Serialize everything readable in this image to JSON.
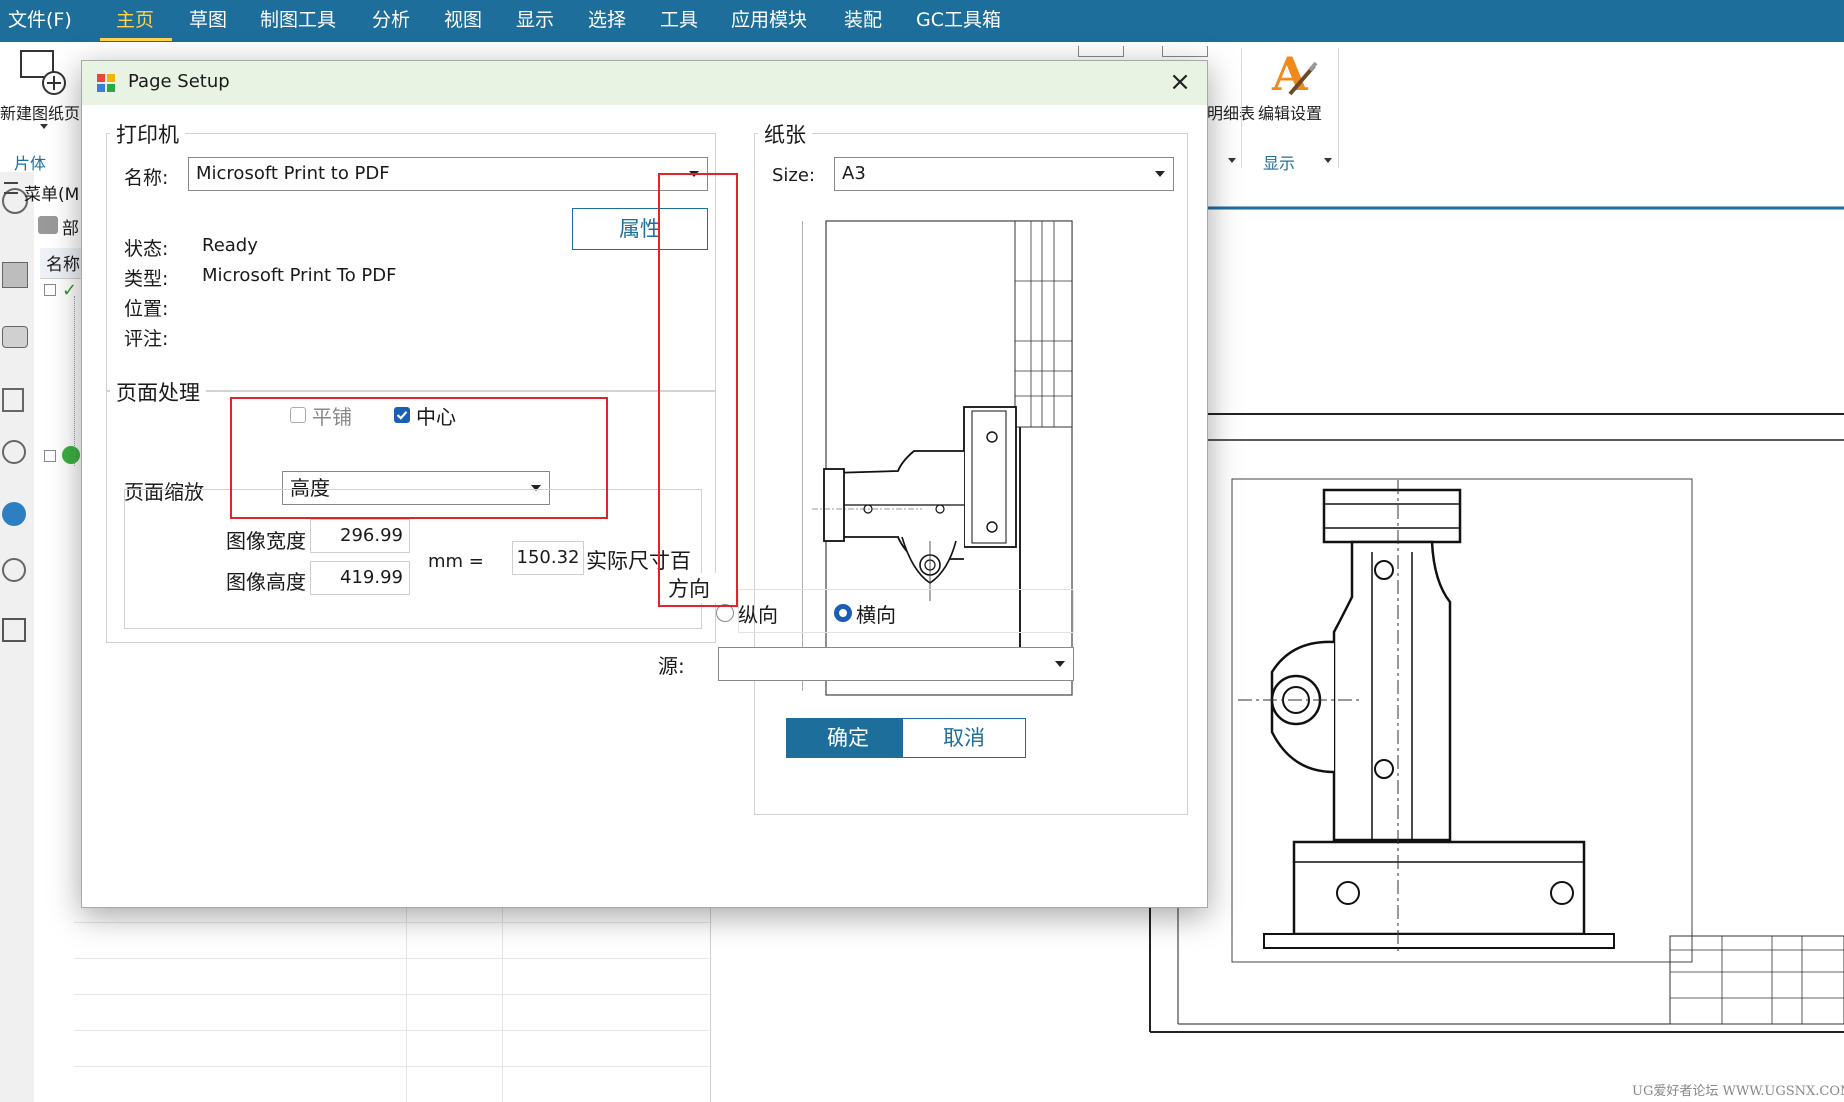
{
  "menubar": {
    "items": [
      "文件(F)",
      "主页",
      "草图",
      "制图工具",
      "分析",
      "视图",
      "显示",
      "选择",
      "工具",
      "应用模块",
      "装配",
      "GC工具箱"
    ],
    "active": "主页"
  },
  "ribbon": {
    "new_sheet": "新建图纸页",
    "group_left": "片体",
    "right_fragment": "明细表",
    "edit_settings": "编辑设置",
    "group_display": "显示"
  },
  "navpanel": {
    "menu": "菜单(M",
    "part_fragment": "部",
    "name_header": "名称"
  },
  "dialog": {
    "title": "Page Setup",
    "printer": {
      "group_title": "打印机",
      "name_label": "名称:",
      "name_value": "Microsoft Print to PDF",
      "properties_button": "属性",
      "status_label": "状态:",
      "status_value": "Ready",
      "type_label": "类型:",
      "type_value": "Microsoft Print To PDF",
      "location_label": "位置:",
      "comment_label": "评注:"
    },
    "page_handling": {
      "group_title": "页面处理",
      "tile_label": "平铺",
      "tile_checked": false,
      "center_label": "中心",
      "center_checked": true,
      "scale_label": "页面缩放",
      "scale_value": "高度",
      "image_width_label": "图像宽度",
      "image_width_value": "296.99",
      "image_height_label": "图像高度",
      "image_height_value": "419.99",
      "mm_label": "mm =",
      "actual_value": "150.32",
      "actual_label": "实际尺寸百"
    },
    "paper": {
      "group_title": "纸张",
      "size_label": "Size:",
      "size_value": "A3",
      "orientation_title": "方向",
      "portrait_label": "纵向",
      "landscape_label": "横向",
      "orientation_selected": "landscape",
      "source_label": "源:",
      "source_value": ""
    },
    "ok_button": "确定",
    "cancel_button": "取消"
  },
  "drawing": {
    "watermark": "UG爱好者论坛 WWW.UGSNX.COM"
  },
  "colors": {
    "menubar": "#1d6e9b",
    "menu_active": "#ffd34a",
    "primary_button": "#1d6e9b",
    "highlight_box": "#e0242b",
    "title_bar": "#e8f3e3"
  }
}
